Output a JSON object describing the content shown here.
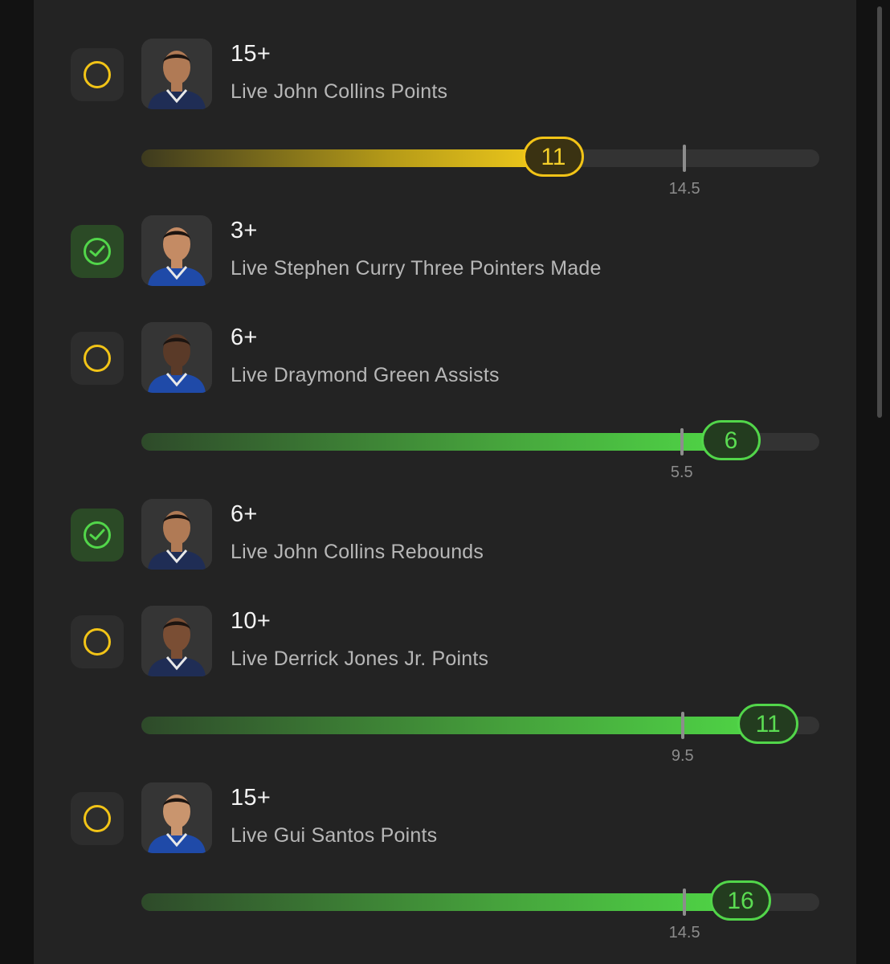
{
  "colors": {
    "pending": "#f2c417",
    "won": "#52d64a",
    "background": "#232323"
  },
  "legs": [
    {
      "line": "15+",
      "market": "Live John Collins Points",
      "status": "pending",
      "status_icon": "empty-circle-icon",
      "avatar_icon": "player-avatar-icon",
      "jersey_color": "#1f2d55",
      "skin_color": "#b07a55",
      "progress": {
        "current": "11",
        "current_value": 11,
        "target": "14.5",
        "target_value": 14.5,
        "scale_max": 18.1,
        "tone": "yellow"
      }
    },
    {
      "line": "3+",
      "market": "Live Stephen Curry Three Pointers Made",
      "status": "won",
      "status_icon": "check-circle-icon",
      "avatar_icon": "player-avatar-icon",
      "jersey_color": "#1f4aa8",
      "skin_color": "#c48b64"
    },
    {
      "line": "6+",
      "market": "Live Draymond Green Assists",
      "status": "pending",
      "status_icon": "empty-circle-icon",
      "avatar_icon": "player-avatar-icon",
      "jersey_color": "#1f4aa8",
      "skin_color": "#5a3a28",
      "progress": {
        "current": "6",
        "current_value": 6,
        "target": "5.5",
        "target_value": 5.5,
        "scale_max": 6.9,
        "tone": "green"
      }
    },
    {
      "line": "6+",
      "market": "Live John Collins Rebounds",
      "status": "won",
      "status_icon": "check-circle-icon",
      "avatar_icon": "player-avatar-icon",
      "jersey_color": "#1f2d55",
      "skin_color": "#b07a55"
    },
    {
      "line": "10+",
      "market": "Live Derrick Jones Jr. Points",
      "status": "pending",
      "status_icon": "empty-circle-icon",
      "avatar_icon": "player-avatar-icon",
      "jersey_color": "#1f2d55",
      "skin_color": "#7a4e34",
      "progress": {
        "current": "11",
        "current_value": 11,
        "target": "9.5",
        "target_value": 9.5,
        "scale_max": 11.9,
        "tone": "green"
      }
    },
    {
      "line": "15+",
      "market": "Live Gui Santos Points",
      "status": "pending",
      "status_icon": "empty-circle-icon",
      "avatar_icon": "player-avatar-icon",
      "jersey_color": "#1f4aa8",
      "skin_color": "#c9956e",
      "progress": {
        "current": "16",
        "current_value": 16,
        "target": "14.5",
        "target_value": 14.5,
        "scale_max": 18.1,
        "tone": "green"
      }
    }
  ]
}
